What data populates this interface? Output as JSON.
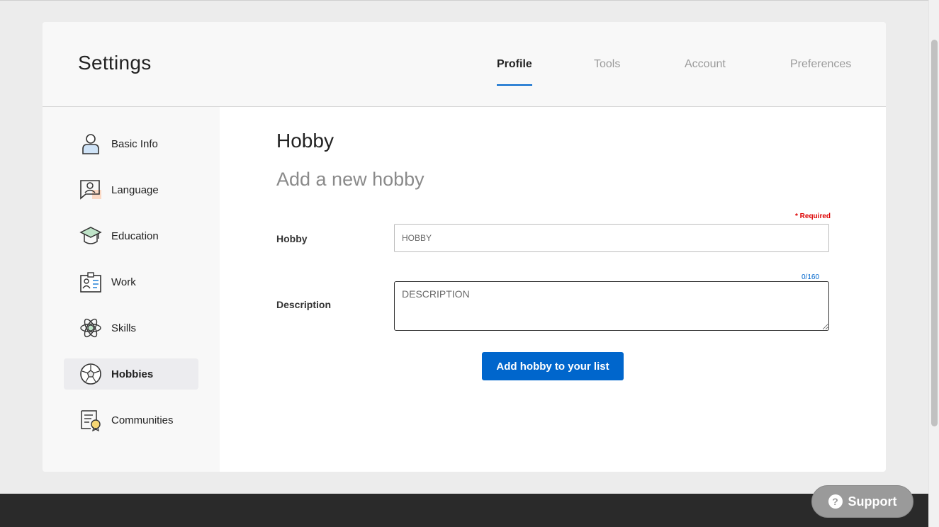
{
  "header": {
    "title": "Settings",
    "tabs": [
      {
        "label": "Profile",
        "active": true
      },
      {
        "label": "Tools",
        "active": false
      },
      {
        "label": "Account",
        "active": false
      },
      {
        "label": "Preferences",
        "active": false
      }
    ]
  },
  "sidebar": {
    "items": [
      {
        "label": "Basic Info",
        "icon": "person-icon"
      },
      {
        "label": "Language",
        "icon": "speech-bubble-icon"
      },
      {
        "label": "Education",
        "icon": "graduation-cap-icon"
      },
      {
        "label": "Work",
        "icon": "id-badge-icon"
      },
      {
        "label": "Skills",
        "icon": "atom-icon"
      },
      {
        "label": "Hobbies",
        "icon": "soccer-ball-icon",
        "active": true
      },
      {
        "label": "Communities",
        "icon": "certificate-icon"
      }
    ]
  },
  "main": {
    "title": "Hobby",
    "subtitle": "Add a new hobby",
    "required_label": "* Required",
    "hobby_label": "Hobby",
    "hobby_placeholder": "HOBBY",
    "description_label": "Description",
    "description_placeholder": "DESCRIPTION",
    "counter": "0/160",
    "submit_label": "Add hobby to your list"
  },
  "support": {
    "label": "Support",
    "icon": "question-icon"
  },
  "colors": {
    "accent": "#0066cc",
    "required": "#dd0000",
    "footer": "#2a2a2a"
  }
}
